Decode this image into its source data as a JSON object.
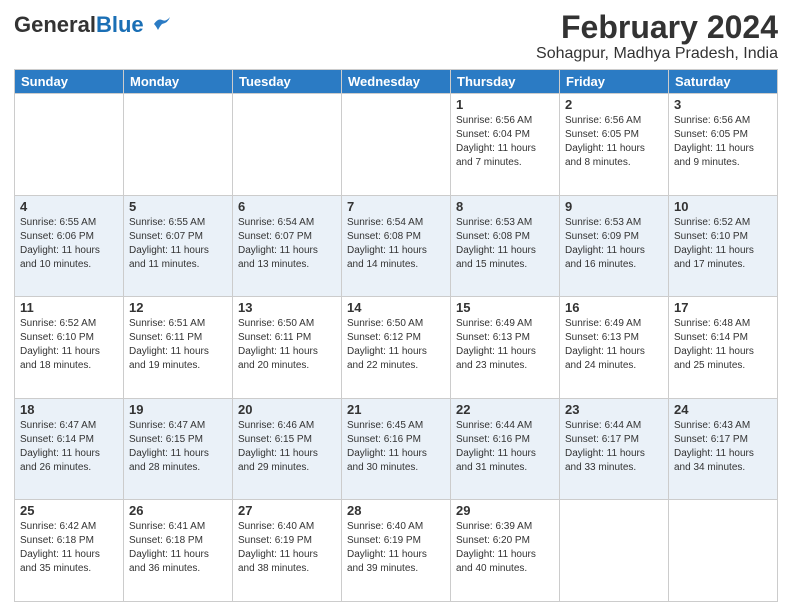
{
  "header": {
    "logo_general": "General",
    "logo_blue": "Blue",
    "month_year": "February 2024",
    "location": "Sohagpur, Madhya Pradesh, India"
  },
  "days_of_week": [
    "Sunday",
    "Monday",
    "Tuesday",
    "Wednesday",
    "Thursday",
    "Friday",
    "Saturday"
  ],
  "weeks": [
    [
      {
        "day": "",
        "sunrise": "",
        "sunset": "",
        "daylight": ""
      },
      {
        "day": "",
        "sunrise": "",
        "sunset": "",
        "daylight": ""
      },
      {
        "day": "",
        "sunrise": "",
        "sunset": "",
        "daylight": ""
      },
      {
        "day": "",
        "sunrise": "",
        "sunset": "",
        "daylight": ""
      },
      {
        "day": "1",
        "sunrise": "Sunrise: 6:56 AM",
        "sunset": "Sunset: 6:04 PM",
        "daylight": "Daylight: 11 hours and 7 minutes."
      },
      {
        "day": "2",
        "sunrise": "Sunrise: 6:56 AM",
        "sunset": "Sunset: 6:05 PM",
        "daylight": "Daylight: 11 hours and 8 minutes."
      },
      {
        "day": "3",
        "sunrise": "Sunrise: 6:56 AM",
        "sunset": "Sunset: 6:05 PM",
        "daylight": "Daylight: 11 hours and 9 minutes."
      }
    ],
    [
      {
        "day": "4",
        "sunrise": "Sunrise: 6:55 AM",
        "sunset": "Sunset: 6:06 PM",
        "daylight": "Daylight: 11 hours and 10 minutes."
      },
      {
        "day": "5",
        "sunrise": "Sunrise: 6:55 AM",
        "sunset": "Sunset: 6:07 PM",
        "daylight": "Daylight: 11 hours and 11 minutes."
      },
      {
        "day": "6",
        "sunrise": "Sunrise: 6:54 AM",
        "sunset": "Sunset: 6:07 PM",
        "daylight": "Daylight: 11 hours and 13 minutes."
      },
      {
        "day": "7",
        "sunrise": "Sunrise: 6:54 AM",
        "sunset": "Sunset: 6:08 PM",
        "daylight": "Daylight: 11 hours and 14 minutes."
      },
      {
        "day": "8",
        "sunrise": "Sunrise: 6:53 AM",
        "sunset": "Sunset: 6:08 PM",
        "daylight": "Daylight: 11 hours and 15 minutes."
      },
      {
        "day": "9",
        "sunrise": "Sunrise: 6:53 AM",
        "sunset": "Sunset: 6:09 PM",
        "daylight": "Daylight: 11 hours and 16 minutes."
      },
      {
        "day": "10",
        "sunrise": "Sunrise: 6:52 AM",
        "sunset": "Sunset: 6:10 PM",
        "daylight": "Daylight: 11 hours and 17 minutes."
      }
    ],
    [
      {
        "day": "11",
        "sunrise": "Sunrise: 6:52 AM",
        "sunset": "Sunset: 6:10 PM",
        "daylight": "Daylight: 11 hours and 18 minutes."
      },
      {
        "day": "12",
        "sunrise": "Sunrise: 6:51 AM",
        "sunset": "Sunset: 6:11 PM",
        "daylight": "Daylight: 11 hours and 19 minutes."
      },
      {
        "day": "13",
        "sunrise": "Sunrise: 6:50 AM",
        "sunset": "Sunset: 6:11 PM",
        "daylight": "Daylight: 11 hours and 20 minutes."
      },
      {
        "day": "14",
        "sunrise": "Sunrise: 6:50 AM",
        "sunset": "Sunset: 6:12 PM",
        "daylight": "Daylight: 11 hours and 22 minutes."
      },
      {
        "day": "15",
        "sunrise": "Sunrise: 6:49 AM",
        "sunset": "Sunset: 6:13 PM",
        "daylight": "Daylight: 11 hours and 23 minutes."
      },
      {
        "day": "16",
        "sunrise": "Sunrise: 6:49 AM",
        "sunset": "Sunset: 6:13 PM",
        "daylight": "Daylight: 11 hours and 24 minutes."
      },
      {
        "day": "17",
        "sunrise": "Sunrise: 6:48 AM",
        "sunset": "Sunset: 6:14 PM",
        "daylight": "Daylight: 11 hours and 25 minutes."
      }
    ],
    [
      {
        "day": "18",
        "sunrise": "Sunrise: 6:47 AM",
        "sunset": "Sunset: 6:14 PM",
        "daylight": "Daylight: 11 hours and 26 minutes."
      },
      {
        "day": "19",
        "sunrise": "Sunrise: 6:47 AM",
        "sunset": "Sunset: 6:15 PM",
        "daylight": "Daylight: 11 hours and 28 minutes."
      },
      {
        "day": "20",
        "sunrise": "Sunrise: 6:46 AM",
        "sunset": "Sunset: 6:15 PM",
        "daylight": "Daylight: 11 hours and 29 minutes."
      },
      {
        "day": "21",
        "sunrise": "Sunrise: 6:45 AM",
        "sunset": "Sunset: 6:16 PM",
        "daylight": "Daylight: 11 hours and 30 minutes."
      },
      {
        "day": "22",
        "sunrise": "Sunrise: 6:44 AM",
        "sunset": "Sunset: 6:16 PM",
        "daylight": "Daylight: 11 hours and 31 minutes."
      },
      {
        "day": "23",
        "sunrise": "Sunrise: 6:44 AM",
        "sunset": "Sunset: 6:17 PM",
        "daylight": "Daylight: 11 hours and 33 minutes."
      },
      {
        "day": "24",
        "sunrise": "Sunrise: 6:43 AM",
        "sunset": "Sunset: 6:17 PM",
        "daylight": "Daylight: 11 hours and 34 minutes."
      }
    ],
    [
      {
        "day": "25",
        "sunrise": "Sunrise: 6:42 AM",
        "sunset": "Sunset: 6:18 PM",
        "daylight": "Daylight: 11 hours and 35 minutes."
      },
      {
        "day": "26",
        "sunrise": "Sunrise: 6:41 AM",
        "sunset": "Sunset: 6:18 PM",
        "daylight": "Daylight: 11 hours and 36 minutes."
      },
      {
        "day": "27",
        "sunrise": "Sunrise: 6:40 AM",
        "sunset": "Sunset: 6:19 PM",
        "daylight": "Daylight: 11 hours and 38 minutes."
      },
      {
        "day": "28",
        "sunrise": "Sunrise: 6:40 AM",
        "sunset": "Sunset: 6:19 PM",
        "daylight": "Daylight: 11 hours and 39 minutes."
      },
      {
        "day": "29",
        "sunrise": "Sunrise: 6:39 AM",
        "sunset": "Sunset: 6:20 PM",
        "daylight": "Daylight: 11 hours and 40 minutes."
      },
      {
        "day": "",
        "sunrise": "",
        "sunset": "",
        "daylight": ""
      },
      {
        "day": "",
        "sunrise": "",
        "sunset": "",
        "daylight": ""
      }
    ]
  ]
}
